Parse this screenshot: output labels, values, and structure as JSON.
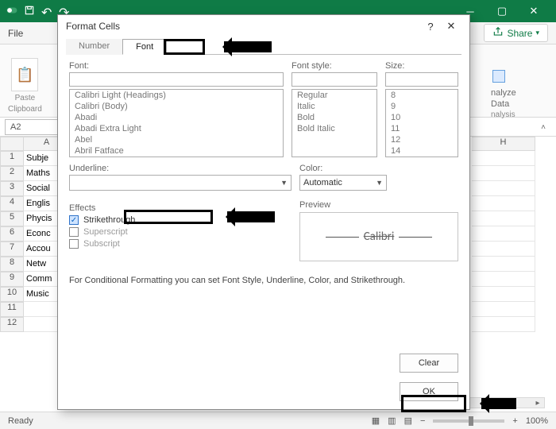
{
  "app": {
    "titlebar": {
      "undo": "↶",
      "redo": "↷"
    },
    "menus": {
      "file": "File"
    },
    "share_label": "Share",
    "ribbon": {
      "paste_label": "Paste",
      "clipboard_group": "Clipboard",
      "analyze_line1": "nalyze",
      "analyze_line2": "Data",
      "analysis_group": "nalysis"
    },
    "namebox_value": "A2",
    "columns_visible": [
      "A",
      "H"
    ],
    "rows": [
      {
        "n": "1",
        "a": "Subje"
      },
      {
        "n": "2",
        "a": "Maths"
      },
      {
        "n": "3",
        "a": "Social"
      },
      {
        "n": "4",
        "a": "Englis"
      },
      {
        "n": "5",
        "a": "Phycis"
      },
      {
        "n": "6",
        "a": "Econc"
      },
      {
        "n": "7",
        "a": "Accou"
      },
      {
        "n": "8",
        "a": "Netw"
      },
      {
        "n": "9",
        "a": "Comm"
      },
      {
        "n": "10",
        "a": "Music"
      },
      {
        "n": "11",
        "a": ""
      },
      {
        "n": "12",
        "a": ""
      }
    ],
    "status": {
      "ready": "Ready",
      "zoom": "100%",
      "plus": "+"
    }
  },
  "dialog": {
    "title": "Format Cells",
    "help": "?",
    "close": "✕",
    "tabs": {
      "number": "Number",
      "font": "Font"
    },
    "labels": {
      "font": "Font:",
      "font_style": "Font style:",
      "size": "Size:",
      "underline": "Underline:",
      "color": "Color:",
      "effects": "Effects",
      "preview": "Preview"
    },
    "font_list": [
      "Calibri Light (Headings)",
      "Calibri (Body)",
      "Abadi",
      "Abadi Extra Light",
      "Abel",
      "Abril Fatface"
    ],
    "style_list": [
      "Regular",
      "Italic",
      "Bold",
      "Bold Italic"
    ],
    "size_list": [
      "8",
      "9",
      "10",
      "11",
      "12",
      "14"
    ],
    "underline_value": "",
    "color_value": "Automatic",
    "effects": {
      "strikethrough": "Strikethrough",
      "superscript": "Superscript",
      "subscript": "Subscript"
    },
    "preview_text": "Calibri",
    "hint": "For Conditional Formatting you can set Font Style, Underline, Color, and Strikethrough.",
    "buttons": {
      "clear": "Clear",
      "ok": "OK"
    }
  }
}
